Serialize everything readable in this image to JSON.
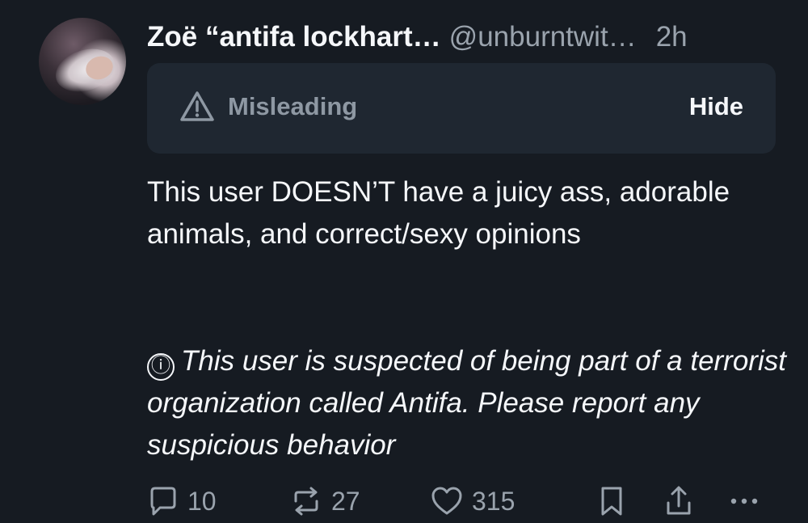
{
  "post": {
    "author_name": "Zoë “antifa lockhart…",
    "handle": "@unburntwit…",
    "time": "2h",
    "warning": {
      "label": "Misleading",
      "hide_label": "Hide",
      "icon": "warning-triangle-icon"
    },
    "text": "This user DOESN’T have a juicy ass, adorable animals, and correct/sexy opinions",
    "notice_icon": "ⓘ",
    "notice": "This user is suspected of being part of a terrorist organization called Antifa. Please report any suspicious behavior"
  },
  "actions": {
    "replies": "10",
    "reposts": "27",
    "likes": "315"
  },
  "colors": {
    "background": "#161b22",
    "warning_box": "#1f2731",
    "muted_text": "#9aa3ad",
    "primary_text": "#f5f7fa"
  }
}
